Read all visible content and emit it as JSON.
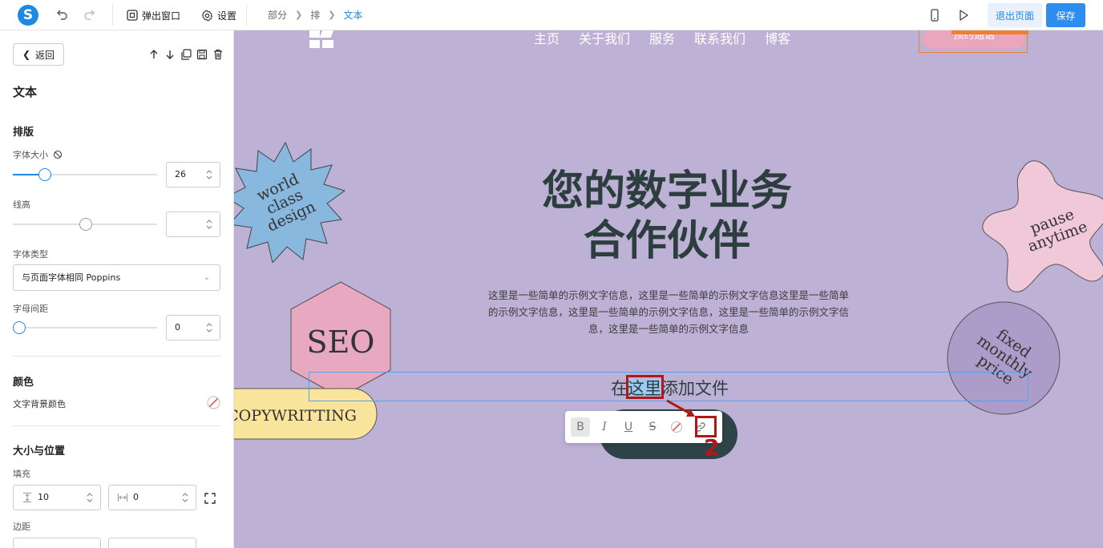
{
  "topbar": {
    "logo_letter": "S",
    "popup_label": "弹出窗口",
    "settings_label": "设置",
    "breadcrumb": [
      "部分",
      "排",
      "文本"
    ],
    "exit_label": "退出页面",
    "save_label": "保存"
  },
  "sidebar": {
    "back_label": "返回",
    "panel_title": "文本",
    "typography_heading": "排版",
    "font_size_label": "字体大小",
    "font_size_value": "26",
    "font_size_fraction": 0.22,
    "line_height_label": "线高",
    "line_height_value": "",
    "line_height_fraction": 0.5,
    "font_type_label": "字体类型",
    "font_type_value": "与页面字体相同 Poppins",
    "letter_spacing_label": "字母间距",
    "letter_spacing_value": "0",
    "letter_spacing_fraction": 0,
    "color_heading": "颜色",
    "text_bg_label": "文字背景颜色",
    "size_heading": "大小与位置",
    "padding_label": "填充",
    "padding_vertical": "10",
    "padding_horizontal": "0",
    "margin_label": "边距"
  },
  "canvas": {
    "nav": [
      "主页",
      "关于我们",
      "服务",
      "联系我们",
      "博客"
    ],
    "top_cta": "预约通话",
    "hero_line1": "您的数字业务",
    "hero_line2": "合作伙伴",
    "paragraph": "这里是一些简单的示例文字信息，这里是一些简单的示例文字信息这里是一些简单的示例文字信息，这里是一些简单的示例文字信息，这里是一些简单的示例文字信息，这里是一些简单的示例文字信息",
    "edit_before": "在",
    "edit_selected": "这里",
    "edit_after": "添加文件",
    "sticker_world": [
      "world",
      "class",
      "design"
    ],
    "sticker_seo": "SEO",
    "sticker_copy": "COPYWRITTING",
    "sticker_pause": [
      "pause",
      "anytime"
    ],
    "sticker_fixed": [
      "fixed",
      "monthly",
      "price"
    ],
    "annotation_number": "2"
  },
  "colors": {
    "accent": "#1e88e5",
    "canvas_bg": "#beb1d6",
    "annotation": "#b01818"
  }
}
